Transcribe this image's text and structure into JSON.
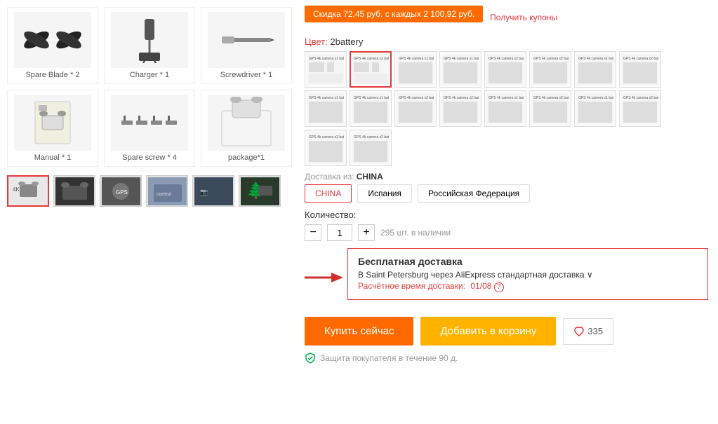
{
  "discount": {
    "text": "Скидка 72,45 руб. с каждых 2 100,92 руб.",
    "coupon": "Получить купоны"
  },
  "color": {
    "label": "Цвет:",
    "value": "2battery"
  },
  "shipping_from": {
    "label": "Доставка из:",
    "value": "CHINA"
  },
  "shipping_options": [
    "CHINA",
    "Испания",
    "Российская Федерация"
  ],
  "quantity": {
    "label": "Количество:",
    "value": "1",
    "stock": "295 шт. в наличии"
  },
  "delivery": {
    "title": "Бесплатная доставка",
    "detail": "В Saint Petersburg через AliExpress стандартная доставка ∨",
    "date_label": "Расчётное время доставки:",
    "date_value": "01/08"
  },
  "buttons": {
    "buy_now": "Купить сейчас",
    "add_to_cart": "Добавить в корзину",
    "wishlist_count": "335"
  },
  "protection": {
    "text": "Защита покупателя в течение 90 д."
  },
  "accessories": [
    {
      "label": "Spare Blade * 2",
      "icon": "✈"
    },
    {
      "label": "Charger * 1",
      "icon": "🔌"
    },
    {
      "label": "Screwdriver * 1",
      "icon": "🔧"
    },
    {
      "label": "Manual * 1",
      "icon": "📄"
    },
    {
      "label": "Spare screw * 4",
      "icon": "🔩"
    },
    {
      "label": "package*1",
      "icon": "📦"
    }
  ],
  "thumbnails": [
    {
      "label": "thumb1",
      "active": true
    },
    {
      "label": "thumb2",
      "active": false
    },
    {
      "label": "thumb3",
      "active": false
    },
    {
      "label": "thumb4",
      "active": false
    },
    {
      "label": "thumb5",
      "active": false
    },
    {
      "label": "thumb6",
      "active": false
    }
  ],
  "variants_row1_count": 8,
  "variants_row2_count": 8,
  "variants_row3_count": 2,
  "selected_variant_index": 1
}
